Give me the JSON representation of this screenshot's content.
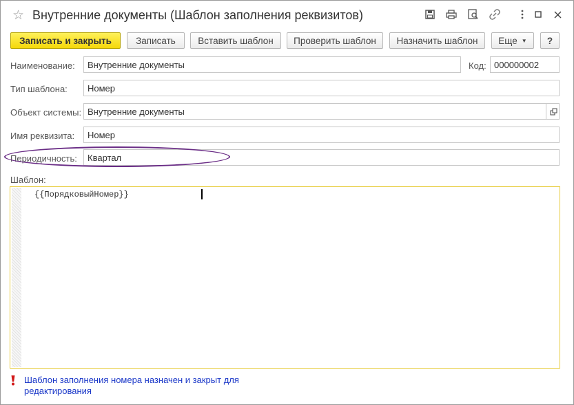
{
  "window": {
    "title": "Внутренние документы (Шаблон заполнения реквизитов)",
    "icons": [
      "star-icon",
      "save-icon",
      "print-icon",
      "preview-icon",
      "link-icon",
      "more-vert-icon",
      "minimize-icon",
      "maximize-icon",
      "close-icon"
    ]
  },
  "toolbar": {
    "save_close": "Записать и закрыть",
    "save": "Записать",
    "insert_template": "Вставить шаблон",
    "check_template": "Проверить шаблон",
    "assign_template": "Назначить шаблон",
    "more": "Еще",
    "help": "?"
  },
  "form": {
    "name_label": "Наименование:",
    "name_value": "Внутренние документы",
    "code_label": "Код:",
    "code_value": "000000002",
    "template_type_label": "Тип шаблона:",
    "template_type_value": "Номер",
    "system_object_label": "Объект системы:",
    "system_object_value": "Внутренние документы",
    "attribute_label": "Имя реквизита:",
    "attribute_value": "Номер",
    "period_label": "Периодичность:",
    "period_value": "Квартал",
    "template_label": "Шаблон:",
    "template_text": "{{ПорядковыйНомер}}"
  },
  "status": {
    "message": "Шаблон заполнения номера назначен и закрыт для редактирования",
    "accent_color": "#1a37c8",
    "highlight_color": "#6a2d86"
  }
}
